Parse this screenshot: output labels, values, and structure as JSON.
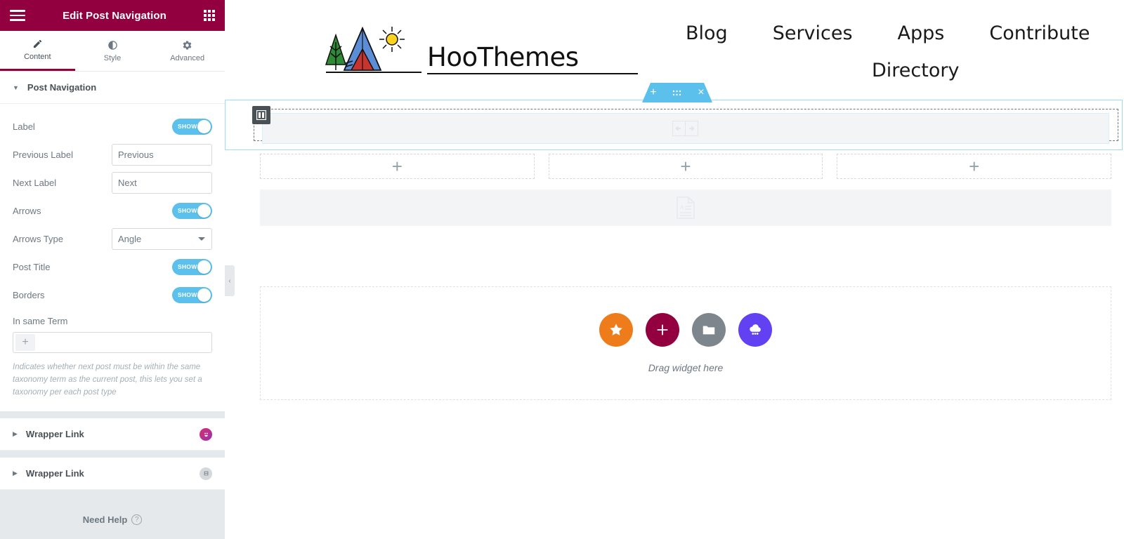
{
  "panel": {
    "title": "Edit Post Navigation",
    "menu_icon": "hamburger-icon",
    "apps_icon": "apps-grid-icon",
    "tabs": [
      {
        "label": "Content",
        "icon": "pencil-icon",
        "active": true
      },
      {
        "label": "Style",
        "icon": "contrast-icon",
        "active": false
      },
      {
        "label": "Advanced",
        "icon": "gear-icon",
        "active": false
      }
    ],
    "sections": [
      {
        "title": "Post Navigation",
        "expanded": true,
        "badge": null
      },
      {
        "title": "Wrapper Link",
        "expanded": false,
        "badge": "pink-avatar-icon"
      },
      {
        "title": "Wrapper Link",
        "expanded": false,
        "badge": "gray-square-icon"
      }
    ],
    "controls": {
      "label": {
        "label": "Label",
        "type": "switch",
        "value": "SHOW"
      },
      "previous_label": {
        "label": "Previous Label",
        "type": "text",
        "value": "Previous",
        "placeholder": "Previous"
      },
      "next_label": {
        "label": "Next Label",
        "type": "text",
        "value": "Next",
        "placeholder": "Next"
      },
      "arrows": {
        "label": "Arrows",
        "type": "switch",
        "value": "SHOW"
      },
      "arrows_type": {
        "label": "Arrows Type",
        "type": "select",
        "value": "Angle"
      },
      "post_title": {
        "label": "Post Title",
        "type": "switch",
        "value": "SHOW"
      },
      "borders": {
        "label": "Borders",
        "type": "switch",
        "value": "SHOW"
      },
      "in_same_term": {
        "label": "In same Term",
        "type": "repeater",
        "add_glyph": "+",
        "description": "Indicates whether next post must be within the same taxonomy term as the current post, this lets you set a taxonomy per each post type"
      }
    },
    "footer": {
      "label": "Need Help",
      "icon": "question-mark-icon"
    },
    "collapse_handle": {
      "icon": "chevron-left-icon",
      "glyph": "‹"
    }
  },
  "canvas": {
    "site": {
      "logo_text": "HooThemes",
      "logo_icons": [
        "tree-icon",
        "tent-icon",
        "sun-icon"
      ],
      "nav_row1": [
        "Blog",
        "Services",
        "Apps",
        "Contribute"
      ],
      "nav_row2": [
        "Directory"
      ]
    },
    "section_toolbar": {
      "add": "+",
      "handle": "⋮⋮",
      "close": "×",
      "names": [
        "add-section-icon",
        "drag-section-icon",
        "delete-section-icon"
      ]
    },
    "widget_handle_icon": "columns-icon",
    "editing_widget_icon": "post-navigation-arrows-icon",
    "add_columns": [
      {
        "glyph": "+"
      },
      {
        "glyph": "+"
      },
      {
        "glyph": "+"
      }
    ],
    "gray_band_icon": "article-document-icon",
    "drop_zone": {
      "text": "Drag widget here",
      "actions": [
        {
          "name": "favorites-button",
          "icon": "star-icon",
          "color": "#ef7c1b"
        },
        {
          "name": "add-widget-button",
          "icon": "plus-icon",
          "color": "#93003f"
        },
        {
          "name": "templates-button",
          "icon": "folder-icon",
          "color": "#7d868c"
        },
        {
          "name": "cloud-templates-button",
          "icon": "cloud-icon",
          "color": "#6141f2"
        }
      ]
    }
  },
  "colors": {
    "brand": "#93003f",
    "accent": "#5bc0eb",
    "panel_bg": "#e6e9ec",
    "text_muted": "#6d7882"
  }
}
